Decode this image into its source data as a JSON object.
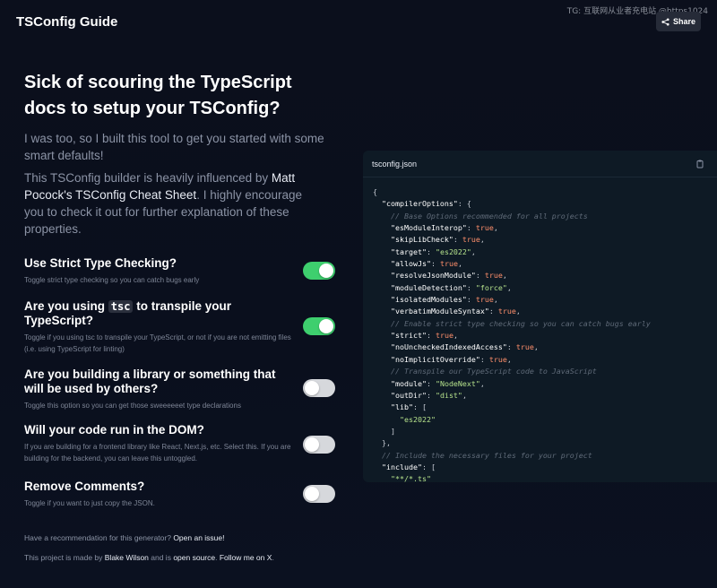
{
  "header": {
    "title": "TSConfig Guide",
    "watermark": "TG: 互联网从业者充电站 @https1024",
    "share_label": "Share"
  },
  "hero": {
    "headline": "Sick of scouring the TypeScript docs to setup your TSConfig?",
    "intro": "I was too, so I built this tool to get you started with some smart defaults!",
    "influence_prefix": "This TSConfig builder is heavily influenced by ",
    "influence_link": "Matt Pocock's TSConfig Cheat Sheet",
    "influence_suffix": ". I highly encourage you to check it out for further explanation of these properties."
  },
  "options": [
    {
      "title": "Use Strict Type Checking?",
      "description": "Toggle strict type checking so you can catch bugs early",
      "enabled": true
    },
    {
      "title_prefix": "Are you using ",
      "title_code": "tsc",
      "title_suffix": " to transpile your TypeScript?",
      "description": "Toggle if you using tsc to transpile your TypeScript, or not if you are not emitting files (i.e. using TypeScript for linting)",
      "enabled": true
    },
    {
      "title": "Are you building a library or something that will be used by others?",
      "description": "Toggle this option so you can get those sweeeeeet type declarations",
      "enabled": false
    },
    {
      "title": "Will your code run in the DOM?",
      "description": "If you are building for a frontend library like React, Next.js, etc. Select this. If you are building for the backend, you can leave this untoggled.",
      "enabled": false
    },
    {
      "title": "Remove Comments?",
      "description": "Toggle if you want to just copy the JSON.",
      "enabled": false
    }
  ],
  "footer": {
    "recommend_text": "Have a recommendation for this generator? ",
    "recommend_link": "Open an issue!",
    "made_by_prefix": "This project is made by ",
    "author_link": "Blake Wilson",
    "made_by_middle": " and is ",
    "open_source_link": "open source",
    "made_by_dot": ". ",
    "follow_link": "Follow me on X",
    "follow_suffix": "."
  },
  "code": {
    "filename": "tsconfig.json",
    "lines": [
      {
        "t": "p",
        "v": "{"
      },
      {
        "t": "mix",
        "parts": [
          [
            "p",
            "  "
          ],
          [
            "k",
            "\"compilerOptions\""
          ],
          [
            "p",
            ": {"
          ]
        ]
      },
      {
        "t": "c",
        "v": "    // Base Options recommended for all projects"
      },
      {
        "t": "mix",
        "parts": [
          [
            "p",
            "    "
          ],
          [
            "k",
            "\"esModuleInterop\""
          ],
          [
            "p",
            ": "
          ],
          [
            "b",
            "true"
          ],
          [
            "p",
            ","
          ]
        ]
      },
      {
        "t": "mix",
        "parts": [
          [
            "p",
            "    "
          ],
          [
            "k",
            "\"skipLibCheck\""
          ],
          [
            "p",
            ": "
          ],
          [
            "b",
            "true"
          ],
          [
            "p",
            ","
          ]
        ]
      },
      {
        "t": "mix",
        "parts": [
          [
            "p",
            "    "
          ],
          [
            "k",
            "\"target\""
          ],
          [
            "p",
            ": "
          ],
          [
            "s",
            "\"es2022\""
          ],
          [
            "p",
            ","
          ]
        ]
      },
      {
        "t": "mix",
        "parts": [
          [
            "p",
            "    "
          ],
          [
            "k",
            "\"allowJs\""
          ],
          [
            "p",
            ": "
          ],
          [
            "b",
            "true"
          ],
          [
            "p",
            ","
          ]
        ]
      },
      {
        "t": "mix",
        "parts": [
          [
            "p",
            "    "
          ],
          [
            "k",
            "\"resolveJsonModule\""
          ],
          [
            "p",
            ": "
          ],
          [
            "b",
            "true"
          ],
          [
            "p",
            ","
          ]
        ]
      },
      {
        "t": "mix",
        "parts": [
          [
            "p",
            "    "
          ],
          [
            "k",
            "\"moduleDetection\""
          ],
          [
            "p",
            ": "
          ],
          [
            "s",
            "\"force\""
          ],
          [
            "p",
            ","
          ]
        ]
      },
      {
        "t": "mix",
        "parts": [
          [
            "p",
            "    "
          ],
          [
            "k",
            "\"isolatedModules\""
          ],
          [
            "p",
            ": "
          ],
          [
            "b",
            "true"
          ],
          [
            "p",
            ","
          ]
        ]
      },
      {
        "t": "mix",
        "parts": [
          [
            "p",
            "    "
          ],
          [
            "k",
            "\"verbatimModuleSyntax\""
          ],
          [
            "p",
            ": "
          ],
          [
            "b",
            "true"
          ],
          [
            "p",
            ","
          ]
        ]
      },
      {
        "t": "c",
        "v": "    // Enable strict type checking so you can catch bugs early"
      },
      {
        "t": "mix",
        "parts": [
          [
            "p",
            "    "
          ],
          [
            "k",
            "\"strict\""
          ],
          [
            "p",
            ": "
          ],
          [
            "b",
            "true"
          ],
          [
            "p",
            ","
          ]
        ]
      },
      {
        "t": "mix",
        "parts": [
          [
            "p",
            "    "
          ],
          [
            "k",
            "\"noUncheckedIndexedAccess\""
          ],
          [
            "p",
            ": "
          ],
          [
            "b",
            "true"
          ],
          [
            "p",
            ","
          ]
        ]
      },
      {
        "t": "mix",
        "parts": [
          [
            "p",
            "    "
          ],
          [
            "k",
            "\"noImplicitOverride\""
          ],
          [
            "p",
            ": "
          ],
          [
            "b",
            "true"
          ],
          [
            "p",
            ","
          ]
        ]
      },
      {
        "t": "c",
        "v": "    // Transpile our TypeScript code to JavaScript"
      },
      {
        "t": "mix",
        "parts": [
          [
            "p",
            "    "
          ],
          [
            "k",
            "\"module\""
          ],
          [
            "p",
            ": "
          ],
          [
            "s",
            "\"NodeNext\""
          ],
          [
            "p",
            ","
          ]
        ]
      },
      {
        "t": "mix",
        "parts": [
          [
            "p",
            "    "
          ],
          [
            "k",
            "\"outDir\""
          ],
          [
            "p",
            ": "
          ],
          [
            "s",
            "\"dist\""
          ],
          [
            "p",
            ","
          ]
        ]
      },
      {
        "t": "mix",
        "parts": [
          [
            "p",
            "    "
          ],
          [
            "k",
            "\"lib\""
          ],
          [
            "p",
            ": ["
          ]
        ]
      },
      {
        "t": "mix",
        "parts": [
          [
            "p",
            "      "
          ],
          [
            "s",
            "\"es2022\""
          ]
        ]
      },
      {
        "t": "p",
        "v": "    ]"
      },
      {
        "t": "p",
        "v": "  },"
      },
      {
        "t": "c",
        "v": "  // Include the necessary files for your project"
      },
      {
        "t": "mix",
        "parts": [
          [
            "p",
            "  "
          ],
          [
            "k",
            "\"include\""
          ],
          [
            "p",
            ": ["
          ]
        ]
      },
      {
        "t": "mix",
        "parts": [
          [
            "p",
            "    "
          ],
          [
            "s",
            "\"**/*.ts\""
          ]
        ]
      }
    ]
  },
  "colors": {
    "background": "#0b0f1c",
    "toggle_on": "#3ecf6e",
    "toggle_off": "#d6d8dc",
    "code_bg": "#0e1a25",
    "bool_color": "#ff8f6b",
    "string_color": "#b5e28c",
    "comment_color": "#5f6a78"
  }
}
